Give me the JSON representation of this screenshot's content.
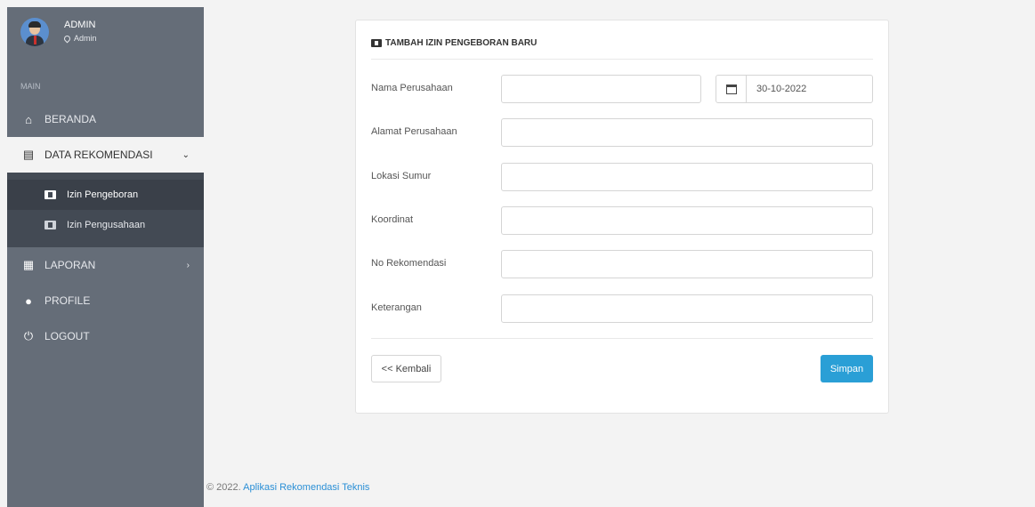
{
  "sidebar": {
    "profile": {
      "name": "ADMIN",
      "role": "Admin"
    },
    "section_label": "MAIN",
    "items": [
      {
        "label": "BERANDA",
        "icon": "home-icon"
      },
      {
        "label": "DATA REKOMENDASI",
        "icon": "document-icon",
        "active": true
      },
      {
        "label": "LAPORAN",
        "icon": "report-icon"
      },
      {
        "label": "PROFILE",
        "icon": "user-icon"
      },
      {
        "label": "LOGOUT",
        "icon": "power-icon"
      }
    ],
    "submenu": [
      {
        "label": "Izin Pengeboran",
        "icon": "folder-download-icon"
      },
      {
        "label": "Izin Pengusahaan",
        "icon": "folder-upload-icon"
      }
    ]
  },
  "form": {
    "title": "TAMBAH IZIN PENGEBORAN BARU",
    "fields": [
      {
        "label": "Nama Perusahaan",
        "value": ""
      },
      {
        "label": "Alamat Perusahaan",
        "value": ""
      },
      {
        "label": "Lokasi Sumur",
        "value": ""
      },
      {
        "label": "Koordinat",
        "value": ""
      },
      {
        "label": "No Rekomendasi",
        "value": ""
      },
      {
        "label": "Keterangan",
        "value": ""
      }
    ],
    "date": "30-10-2022",
    "back_label": "<< Kembali",
    "save_label": "Simpan"
  },
  "footer": {
    "copyright": "© 2022.",
    "link": "Aplikasi Rekomendasi Teknis"
  },
  "colors": {
    "sidebar": "#656d78",
    "submenu": "#434a54",
    "primary": "#2a9fd6"
  }
}
